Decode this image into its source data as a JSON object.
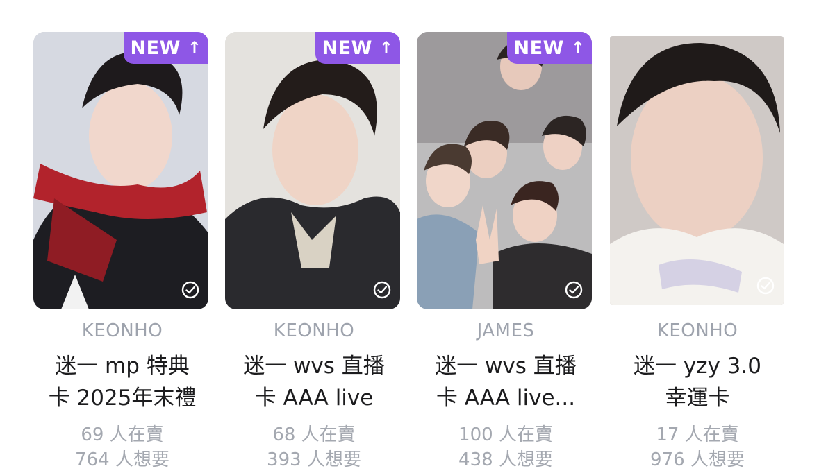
{
  "cards": [
    {
      "badge": "NEW",
      "member": "KEONHO",
      "title_line1": "迷一 mp 特典",
      "title_line2": "卡 2025年末禮",
      "selling": "69 人在賣",
      "wanting": "764 人想要"
    },
    {
      "badge": "NEW",
      "member": "KEONHO",
      "title_line1": "迷一 wvs 直播",
      "title_line2": "卡 AAA live",
      "selling": "68 人在賣",
      "wanting": "393 人想要"
    },
    {
      "badge": "NEW",
      "member": "JAMES",
      "title_line1": "迷一 wvs 直播",
      "title_line2": "卡 AAA live...",
      "selling": "100 人在賣",
      "wanting": "438 人想要"
    },
    {
      "badge": "",
      "member": "KEONHO",
      "title_line1": "迷一 yzy 3.0",
      "title_line2": "幸運卡",
      "selling": "17 人在賣",
      "wanting": "976 人想要"
    }
  ],
  "colors": {
    "badge_bg": "#8e57e6",
    "member_text": "#9ea3ad",
    "title_text": "#1c1c1e",
    "stat_text": "#a4a8b0"
  },
  "icons": {
    "badge_arrow": "arrow-up-icon",
    "check": "check-circle-icon"
  }
}
